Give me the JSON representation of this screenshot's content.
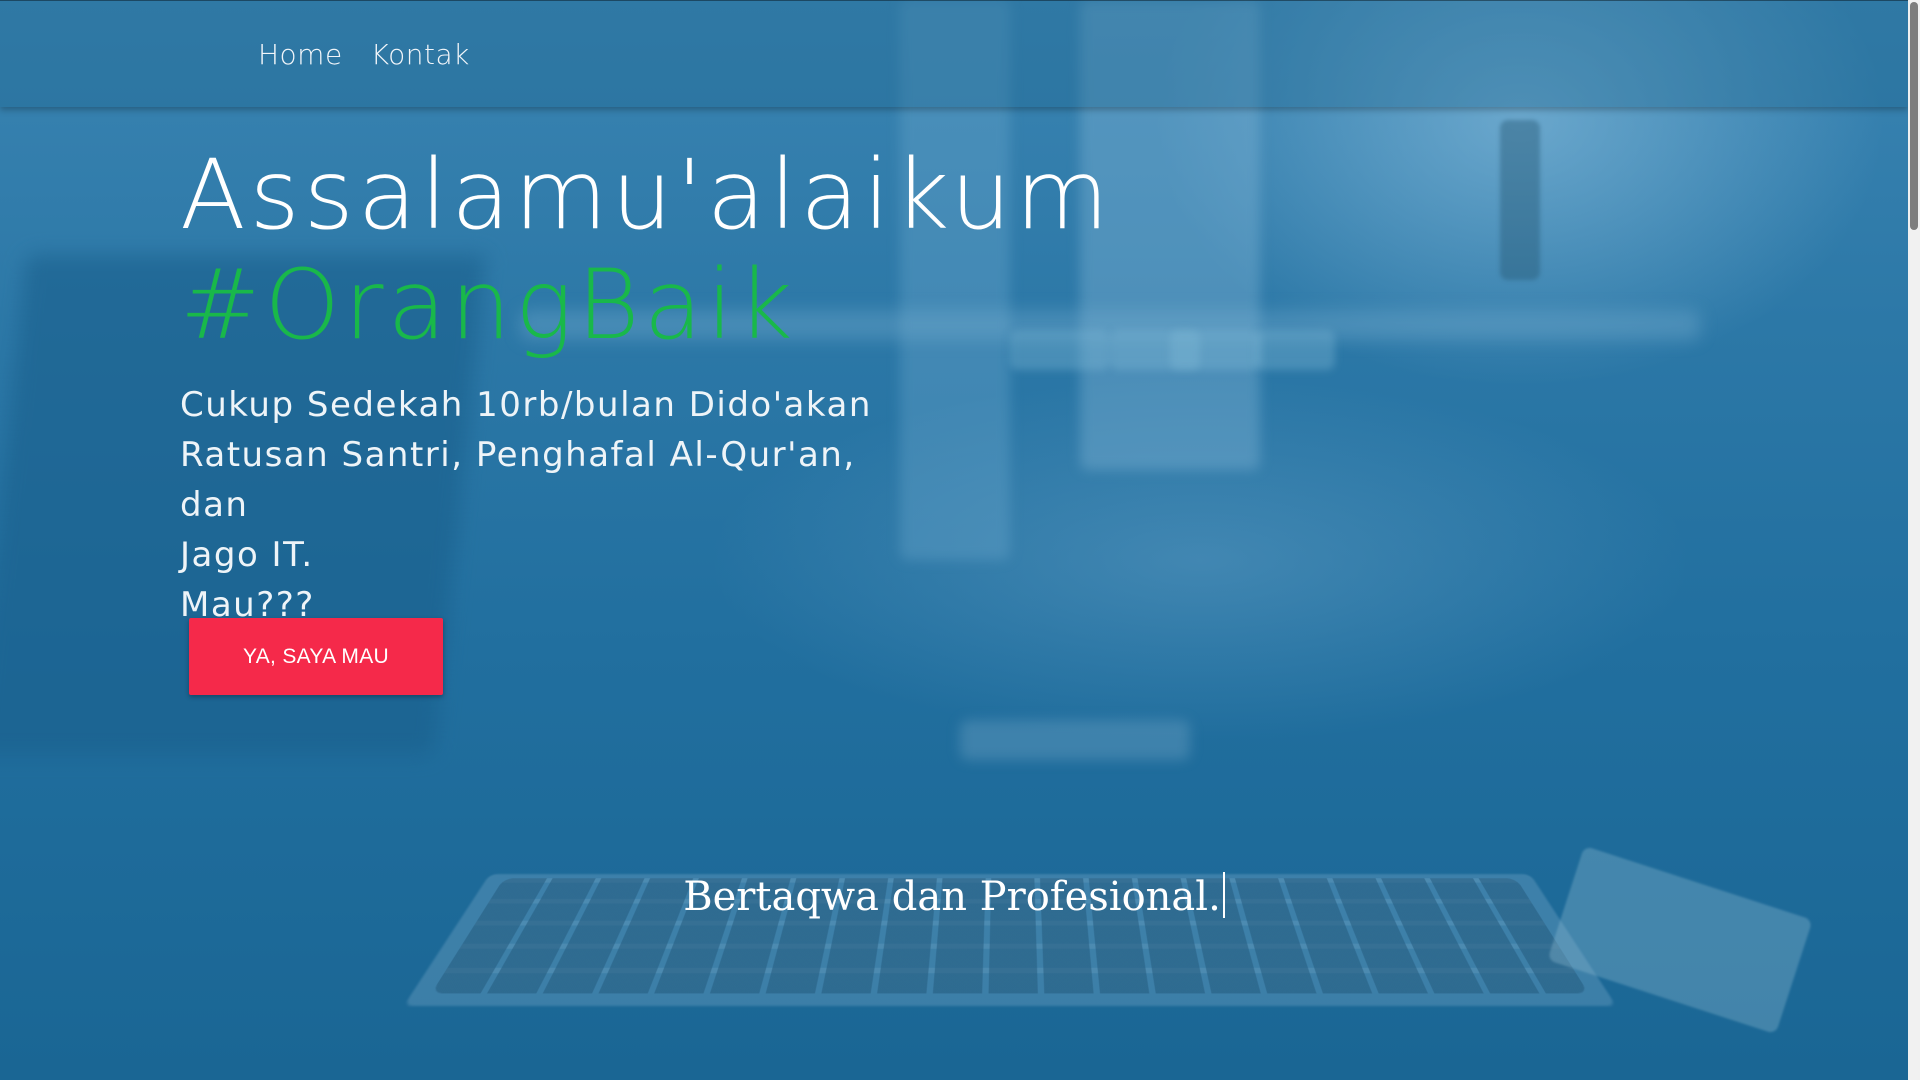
{
  "nav": {
    "links": [
      {
        "label": "Home"
      },
      {
        "label": "Kontak"
      }
    ]
  },
  "hero": {
    "title": "Assalamu'alaikum",
    "hashtag": "#OrangBaik",
    "description_lines": [
      "Cukup Sedekah 10rb/bulan Dido'akan",
      "Ratusan Santri, Penghafal Al-Qur'an, dan",
      "Jago IT.",
      "Mau???"
    ],
    "cta_label": "YA, SAYA MAU"
  },
  "tagline": "Bertaqwa dan Profesional.",
  "colors": {
    "accent_green": "#19b84a",
    "cta_red": "#f5294a",
    "overlay_blue": "#1b6a96"
  }
}
